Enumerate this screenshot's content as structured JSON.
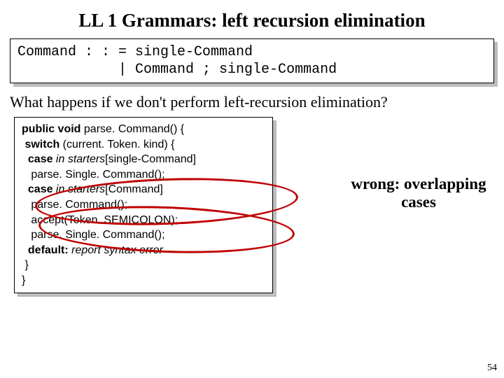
{
  "title": "LL 1 Grammars: left recursion elimination",
  "grammar": {
    "line1": "Command : : = single-Command",
    "line2": "            | Command ; single-Command"
  },
  "question": "What happens if we don't perform left-recursion elimination?",
  "code": {
    "l1a": "public void",
    "l1b": " parse. Command() {",
    "l2a": " switch",
    "l2b": " (current. Token. kind) {",
    "l3a": "  case",
    "l3b": " in starters",
    "l3c": "[single-Command]",
    "l4": "   parse. Single. Command();",
    "l5a": "  case",
    "l5b": " in starters",
    "l5c": "[Command]",
    "l6": "   parse. Command();",
    "l7": "   accept(Token. SEMICOLON);",
    "l8": "   parse. Single. Command();",
    "l9a": "  default:",
    "l9b": " report syntax error",
    "l10": " }",
    "l11": "}"
  },
  "annotation": {
    "line1": "wrong: overlapping",
    "line2": "cases"
  },
  "page_number": "54"
}
